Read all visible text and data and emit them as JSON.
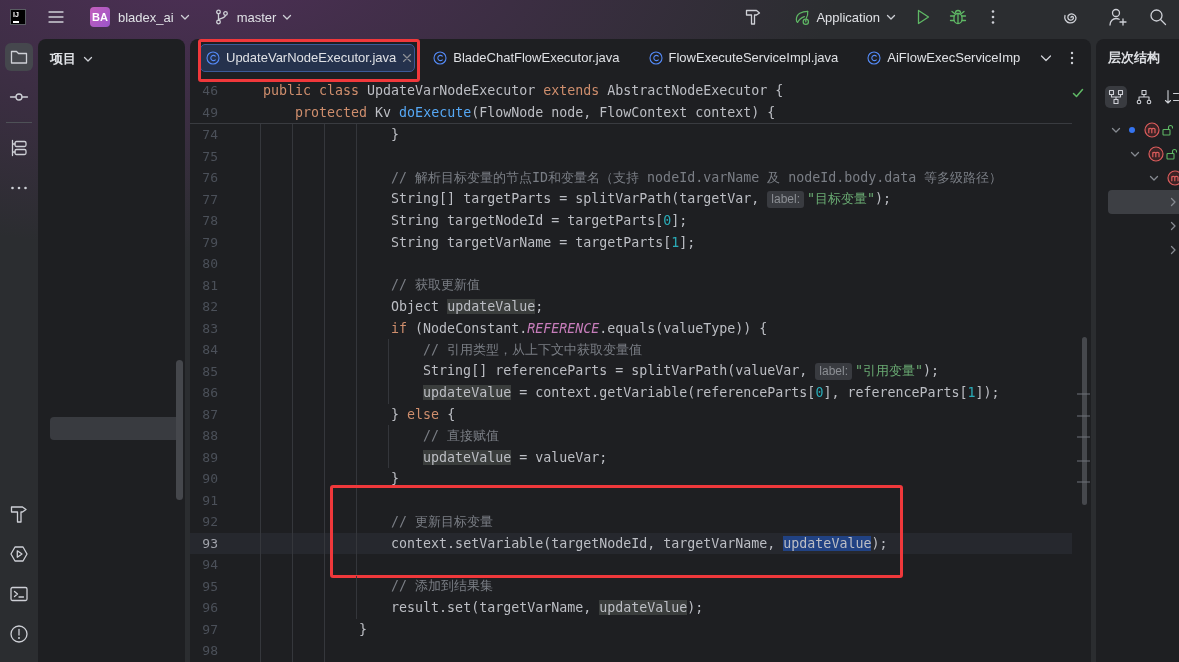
{
  "topbar": {
    "logo": "IJ",
    "project": {
      "badge": "BA",
      "name": "bladex_ai"
    },
    "branch": "master",
    "run_config": "Application"
  },
  "tool_strip": {
    "groups": [
      [
        {
          "kind": "folder",
          "selected": true
        },
        {
          "kind": "commit",
          "selected": false
        }
      ],
      [
        {
          "kind": "structure",
          "selected": false
        },
        {
          "kind": "more",
          "selected": false
        }
      ]
    ],
    "bottom": [
      {
        "kind": "hammer",
        "selected": false
      },
      {
        "kind": "services",
        "selected": false
      },
      {
        "kind": "terminal",
        "selected": false
      },
      {
        "kind": "problems",
        "selected": false
      }
    ]
  },
  "project_panel": {
    "title": "项目",
    "rows": [
      {
        "selected": true
      }
    ]
  },
  "editor": {
    "tabs": [
      {
        "label": "UpdateVarNodeExecutor.java",
        "selected": true,
        "annotated": true
      },
      {
        "label": "BladeChatFlowExecutor.java",
        "selected": false,
        "annotated": false
      },
      {
        "label": "FlowExecuteServiceImpl.java",
        "selected": false,
        "annotated": false
      },
      {
        "label": "AiFlowExecServiceImp",
        "selected": false,
        "annotated": false
      }
    ],
    "sticky_lines": [
      {
        "number": "46",
        "tokens": [
          {
            "kind": "keyword",
            "text": "public class"
          },
          {
            "kind": "plain",
            "text": " UpdateVarNodeExecutor "
          },
          {
            "kind": "keyword",
            "text": "extends"
          },
          {
            "kind": "plain",
            "text": " AbstractNodeExecutor {"
          }
        ]
      },
      {
        "number": "49",
        "tokens": [
          {
            "kind": "keyword",
            "text": "    protected"
          },
          {
            "kind": "plain",
            "text": " Kv "
          },
          {
            "kind": "method",
            "text": "doExecute"
          },
          {
            "kind": "plain",
            "text": "(FlowNode node, FlowContext context) {"
          }
        ]
      }
    ],
    "lines": [
      {
        "number": "74",
        "current": false,
        "annotated": false,
        "tokens": [
          {
            "kind": "plain",
            "text": "                }"
          }
        ]
      },
      {
        "number": "75",
        "current": false,
        "annotated": false
      },
      {
        "number": "76",
        "current": false,
        "annotated": false,
        "tokens": [
          {
            "kind": "comment",
            "text": "                // 解析目标变量的节点ID和变量名（支持 nodeId.varName 及 nodeId.body.data 等多级路径）"
          }
        ]
      },
      {
        "number": "77",
        "current": false,
        "annotated": false,
        "tokens": [
          {
            "kind": "plain",
            "text": "                String[] targetParts = splitVarPath(targetVar, "
          },
          {
            "kind": "hint",
            "text": "label:"
          },
          {
            "kind": "string",
            "text": "\"目标变量\""
          },
          {
            "kind": "plain",
            "text": ");"
          }
        ]
      },
      {
        "number": "78",
        "current": false,
        "annotated": false,
        "tokens": [
          {
            "kind": "plain",
            "text": "                String targetNodeId = targetParts["
          },
          {
            "kind": "number",
            "text": "0"
          },
          {
            "kind": "plain",
            "text": "];"
          }
        ]
      },
      {
        "number": "79",
        "current": false,
        "annotated": false,
        "tokens": [
          {
            "kind": "plain",
            "text": "                String targetVarName = targetParts["
          },
          {
            "kind": "number",
            "text": "1"
          },
          {
            "kind": "plain",
            "text": "];"
          }
        ]
      },
      {
        "number": "80",
        "current": false,
        "annotated": false
      },
      {
        "number": "81",
        "current": false,
        "annotated": false,
        "tokens": [
          {
            "kind": "comment",
            "text": "                // 获取更新值"
          }
        ]
      },
      {
        "number": "82",
        "current": false,
        "annotated": false,
        "tokens": [
          {
            "kind": "plain",
            "text": "                Object "
          },
          {
            "kind": "usage",
            "text": "updateValue"
          },
          {
            "kind": "plain",
            "text": ";"
          }
        ]
      },
      {
        "number": "83",
        "current": false,
        "annotated": false,
        "tokens": [
          {
            "kind": "keyword",
            "text": "                if"
          },
          {
            "kind": "plain",
            "text": " (NodeConstant."
          },
          {
            "kind": "constant",
            "text": "REFERENCE"
          },
          {
            "kind": "plain",
            "text": ".equals(valueType)) {"
          }
        ]
      },
      {
        "number": "84",
        "current": false,
        "annotated": false,
        "tokens": [
          {
            "kind": "comment",
            "text": "                    // 引用类型，从上下文中获取变量值"
          }
        ]
      },
      {
        "number": "85",
        "current": false,
        "annotated": false,
        "tokens": [
          {
            "kind": "plain",
            "text": "                    String[] referenceParts = splitVarPath(valueVar, "
          },
          {
            "kind": "hint",
            "text": "label:"
          },
          {
            "kind": "string",
            "text": "\"引用变量\""
          },
          {
            "kind": "plain",
            "text": ");"
          }
        ]
      },
      {
        "number": "86",
        "current": false,
        "annotated": false,
        "tokens": [
          {
            "kind": "usage",
            "text": "                    updateValue"
          },
          {
            "kind": "plain",
            "text": " = context.getVariable(referenceParts["
          },
          {
            "kind": "number",
            "text": "0"
          },
          {
            "kind": "plain",
            "text": "], referenceParts["
          },
          {
            "kind": "number",
            "text": "1"
          },
          {
            "kind": "plain",
            "text": "]);"
          }
        ]
      },
      {
        "number": "87",
        "current": false,
        "annotated": false,
        "tokens": [
          {
            "kind": "plain",
            "text": "                } "
          },
          {
            "kind": "keyword",
            "text": "else"
          },
          {
            "kind": "plain",
            "text": " {"
          }
        ]
      },
      {
        "number": "88",
        "current": false,
        "annotated": false,
        "tokens": [
          {
            "kind": "comment",
            "text": "                    // 直接赋值"
          }
        ]
      },
      {
        "number": "89",
        "current": false,
        "annotated": false,
        "tokens": [
          {
            "kind": "usage",
            "text": "                    updateValue"
          },
          {
            "kind": "plain",
            "text": " = valueVar;"
          }
        ]
      },
      {
        "number": "90",
        "current": false,
        "annotated": false,
        "tokens": [
          {
            "kind": "plain",
            "text": "                }"
          }
        ]
      },
      {
        "number": "91",
        "current": false,
        "annotated": true
      },
      {
        "number": "92",
        "current": false,
        "annotated": true,
        "tokens": [
          {
            "kind": "comment",
            "text": "                // 更新目标变量"
          }
        ]
      },
      {
        "number": "93",
        "current": true,
        "annotated": true,
        "tokens": [
          {
            "kind": "plain",
            "text": "                context.setVariable(targetNodeId, targetVarName, "
          },
          {
            "kind": "selection",
            "text": "updateValue"
          },
          {
            "kind": "plain",
            "text": ");"
          }
        ]
      },
      {
        "number": "94",
        "current": false,
        "annotated": true
      },
      {
        "number": "95",
        "current": false,
        "annotated": false,
        "tokens": [
          {
            "kind": "comment",
            "text": "                // 添加到结果集"
          }
        ]
      },
      {
        "number": "96",
        "current": false,
        "annotated": false,
        "tokens": [
          {
            "kind": "plain",
            "text": "                result.set(targetVarName, "
          },
          {
            "kind": "usage",
            "text": "updateValue"
          },
          {
            "kind": "plain",
            "text": ");"
          }
        ]
      },
      {
        "number": "97",
        "current": false,
        "annotated": false,
        "tokens": [
          {
            "kind": "plain",
            "text": "            }"
          }
        ]
      },
      {
        "number": "98",
        "current": false,
        "annotated": false
      }
    ]
  },
  "hierarchy_panel": {
    "title": "层次结构",
    "view_buttons": [
      {
        "kind": "hierarchy",
        "selected": true
      },
      {
        "kind": "subtypes",
        "selected": false
      },
      {
        "kind": "sort",
        "selected": false
      }
    ],
    "tree": [
      {
        "kind": "method",
        "current": true,
        "expanded": true,
        "selected": false,
        "children": [
          {
            "kind": "method",
            "current": false,
            "expanded": true,
            "selected": false,
            "children": [
              {
                "kind": "method",
                "current": false,
                "expanded": true,
                "selected": false,
                "children": [
                  {
                    "expanded": false,
                    "current": false,
                    "selected": true
                  },
                  {
                    "expanded": false,
                    "current": false,
                    "selected": false
                  },
                  {
                    "expanded": false,
                    "current": false,
                    "selected": false
                  }
                ]
              }
            ]
          }
        ]
      }
    ]
  }
}
